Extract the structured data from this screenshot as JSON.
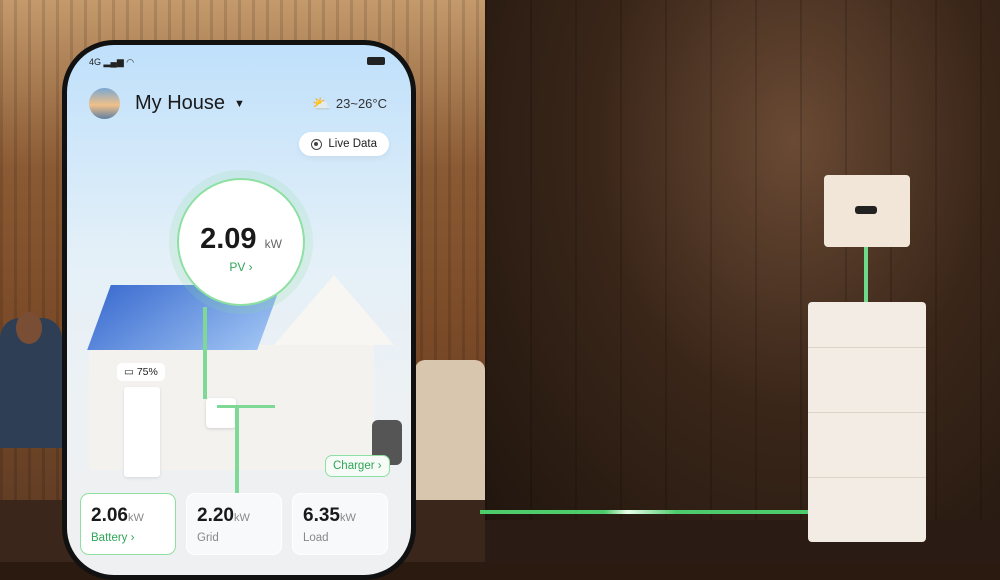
{
  "status_bar": {
    "network": "4G",
    "signal_icon": "signal-icon",
    "wifi_icon": "wifi-icon",
    "battery_icon": "battery-icon"
  },
  "header": {
    "title": "My House",
    "weather_icon": "partly-sunny-icon",
    "temperature": "23~26°C"
  },
  "live_data_label": "Live Data",
  "pv": {
    "value": "2.09",
    "unit": "kW",
    "label": "PV ›"
  },
  "battery_level": "75%",
  "charger_label": "Charger ›",
  "cards": [
    {
      "value": "2.06",
      "unit": "kW",
      "label": "Battery ›",
      "active": true
    },
    {
      "value": "2.20",
      "unit": "kW",
      "label": "Grid"
    },
    {
      "value": "6.35",
      "unit": "kW",
      "label": "Load"
    }
  ],
  "colors": {
    "accent_green": "#2fa557",
    "flow_green": "#7ed896"
  }
}
